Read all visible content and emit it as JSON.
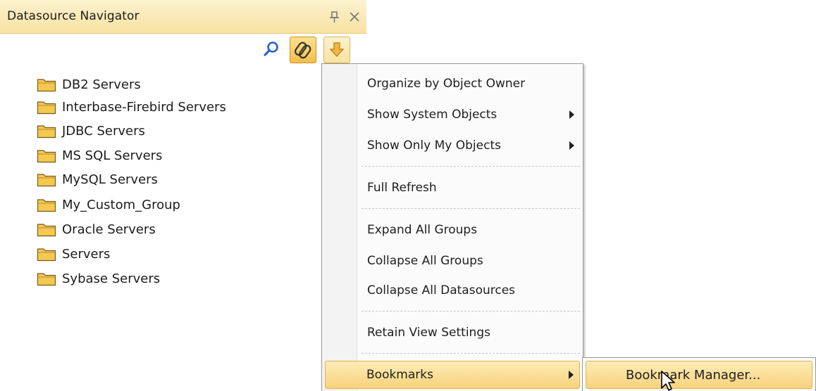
{
  "panel": {
    "title": "Datasource Navigator",
    "search": {
      "value": "",
      "placeholder": ""
    }
  },
  "toolbar": {
    "icons": [
      "search-icon",
      "link-icon",
      "down-arrow-icon"
    ]
  },
  "tree": {
    "items": [
      {
        "label": "DB2 Servers",
        "icon": "folder-icon"
      },
      {
        "label": "Interbase-Firebird Servers",
        "icon": "folder-icon"
      },
      {
        "label": "JDBC Servers",
        "icon": "folder-icon"
      },
      {
        "label": "MS SQL Servers",
        "icon": "folder-icon"
      },
      {
        "label": "MySQL Servers",
        "icon": "folder-icon"
      },
      {
        "label": "My_Custom_Group",
        "icon": "folder-icon"
      },
      {
        "label": "Oracle Servers",
        "icon": "folder-icon"
      },
      {
        "label": "Servers",
        "icon": "folder-icon"
      },
      {
        "label": "Sybase Servers",
        "icon": "folder-icon"
      }
    ]
  },
  "menu": {
    "items": [
      {
        "label": "Organize by Object Owner"
      },
      {
        "label": "Show System Objects",
        "submenu": true
      },
      {
        "label": "Show Only My Objects",
        "submenu": true
      },
      {
        "label": "Full Refresh"
      },
      {
        "label": "Expand All Groups"
      },
      {
        "label": "Collapse All Groups"
      },
      {
        "label": "Collapse All Datasources"
      },
      {
        "label": "Retain View Settings"
      },
      {
        "label": "Bookmarks",
        "submenu": true,
        "active": true
      }
    ]
  },
  "submenu": {
    "items": [
      {
        "label": "Bookmark Manager...",
        "active": true
      }
    ]
  },
  "colors": {
    "title_bar": "#f8e2a2",
    "highlight": "#f7d27c",
    "folder": "#f5c850"
  }
}
